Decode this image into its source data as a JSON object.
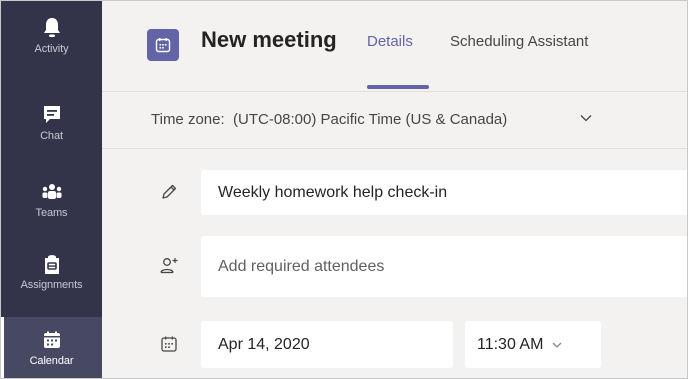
{
  "rail": {
    "items": [
      {
        "label": "Activity",
        "icon": "bell-icon"
      },
      {
        "label": "Chat",
        "icon": "chat-icon"
      },
      {
        "label": "Teams",
        "icon": "teams-icon"
      },
      {
        "label": "Assignments",
        "icon": "assignments-icon"
      },
      {
        "label": "Calendar",
        "icon": "calendar-icon",
        "active": true
      }
    ]
  },
  "header": {
    "title": "New meeting",
    "tabs": [
      {
        "label": "Details",
        "selected": true
      },
      {
        "label": "Scheduling Assistant",
        "selected": false
      }
    ]
  },
  "timezone": {
    "label": "Time zone:",
    "value": "(UTC-08:00) Pacific Time (US & Canada)"
  },
  "form": {
    "title_value": "Weekly homework help check-in",
    "attendees_placeholder": "Add required attendees",
    "start_date": "Apr 14, 2020",
    "start_time": "11:30 AM"
  },
  "colors": {
    "rail_bg": "#33344a",
    "accent": "#6264a7",
    "canvas_bg": "#f3f2f1"
  }
}
